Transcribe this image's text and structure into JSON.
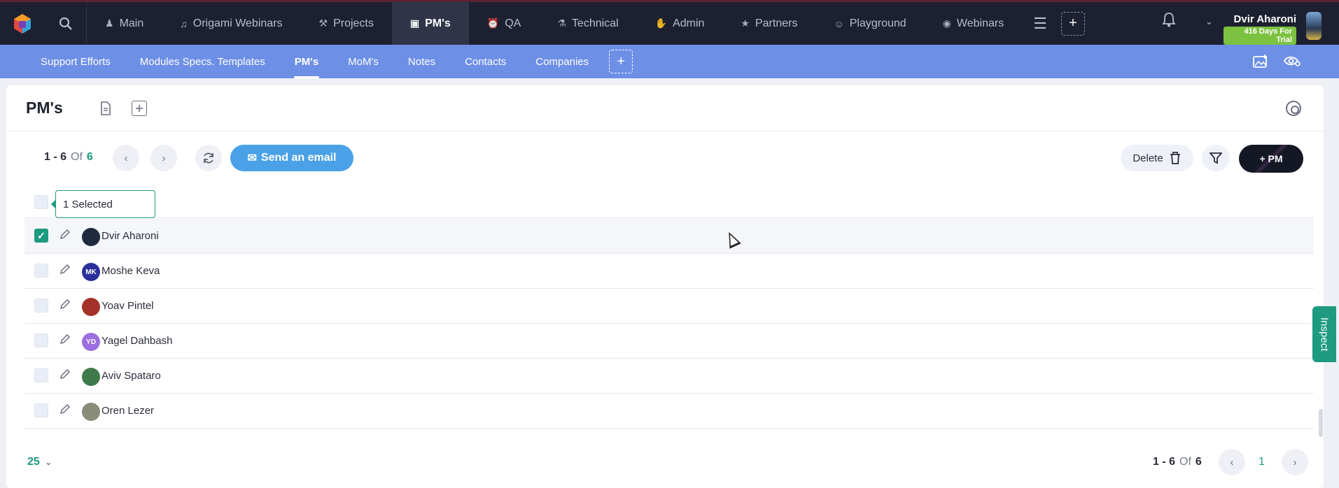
{
  "topnav": {
    "tabs": [
      {
        "label": "Main",
        "icon": "person-icon"
      },
      {
        "label": "Origami Webinars",
        "icon": "music-icon"
      },
      {
        "label": "Projects",
        "icon": "hammer-icon"
      },
      {
        "label": "PM's",
        "icon": "briefcase-icon",
        "active": true
      },
      {
        "label": "QA",
        "icon": "alarm-icon"
      },
      {
        "label": "Technical",
        "icon": "flask-icon"
      },
      {
        "label": "Admin",
        "icon": "thumbs-down-icon"
      },
      {
        "label": "Partners",
        "icon": "star-icon"
      },
      {
        "label": "Playground",
        "icon": "smile-icon"
      },
      {
        "label": "Webinars",
        "icon": "broadcast-icon"
      }
    ],
    "user_name": "Dvir Aharoni",
    "trial_badge": "416 Days For Trial"
  },
  "subnav": {
    "tabs": [
      {
        "label": "Support Efforts"
      },
      {
        "label": "Modules Specs. Templates"
      },
      {
        "label": "PM's",
        "active": true
      },
      {
        "label": "MoM's"
      },
      {
        "label": "Notes"
      },
      {
        "label": "Contacts"
      },
      {
        "label": "Companies"
      }
    ]
  },
  "panel": {
    "title": "PM's",
    "pager": {
      "range": "1 - 6",
      "of": "Of",
      "total": "6"
    },
    "email_button": "Send an email",
    "delete_button": "Delete",
    "add_button": "+ PM",
    "selected_label": "1 Selected",
    "rows": [
      {
        "name": "Dvir Aharoni",
        "initials": "",
        "avatar_color": "#1f2a3e",
        "checked": true
      },
      {
        "name": "Moshe Keva",
        "initials": "MK",
        "avatar_color": "#2a2f9c",
        "checked": false
      },
      {
        "name": "Yoav Pintel",
        "initials": "",
        "avatar_color": "#a4322b",
        "checked": false
      },
      {
        "name": "Yagel Dahbash",
        "initials": "YD",
        "avatar_color": "#9b6fe0",
        "checked": false
      },
      {
        "name": "Aviv Spataro",
        "initials": "",
        "avatar_color": "#3f7a4a",
        "checked": false
      },
      {
        "name": "Oren Lezer",
        "initials": "",
        "avatar_color": "#8a8c7a",
        "checked": false
      }
    ],
    "footer": {
      "per_page": "25",
      "range": "1 - 6",
      "of": "Of",
      "total": "6",
      "page": "1"
    }
  },
  "inspect_label": "Inspect",
  "colors": {
    "accent": "#1e9a80",
    "subnav": "#6d8fe6",
    "topbar": "#1d2030",
    "email": "#4aa1e8"
  }
}
